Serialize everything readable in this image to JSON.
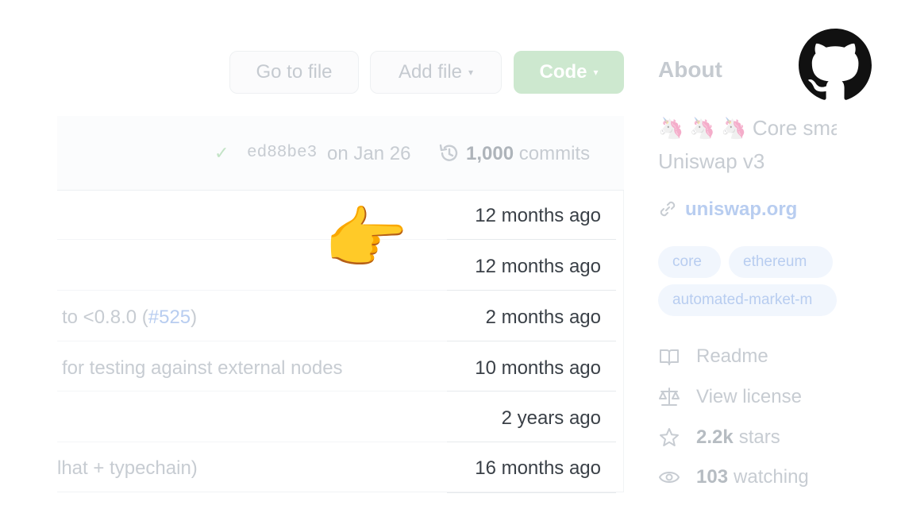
{
  "toolbar": {
    "go_to_file": "Go to file",
    "add_file": "Add file",
    "code": "Code",
    "caret": "▾"
  },
  "commit": {
    "check": "✓",
    "sha": "ed88be3",
    "date": "on Jan 26",
    "count": "1,000",
    "count_label": "commits"
  },
  "files": [
    {
      "message": "",
      "age": "12 months ago"
    },
    {
      "message": "",
      "age": "12 months ago"
    },
    {
      "message_prefix": "to <0.8.0 (",
      "link": "#525",
      "message_suffix": ")",
      "age": "2 months ago"
    },
    {
      "message": "for testing against external nodes",
      "age": "10 months ago"
    },
    {
      "message": "",
      "age": "2 years ago"
    },
    {
      "message": "lhat + typechain)",
      "age": "16 months ago"
    }
  ],
  "about": {
    "title": "About",
    "unicorns": "🦄 🦄 🦄",
    "desc_line1": "Core sma",
    "desc_line2": "Uniswap v3",
    "website": "uniswap.org",
    "topics": [
      "core",
      "ethereum",
      "automated-market-m"
    ],
    "readme": "Readme",
    "license": "View license",
    "stars_count": "2.2k",
    "stars_label": "stars",
    "watching_count": "103",
    "watching_label": "watching"
  },
  "overlay": {
    "pointer_emoji": "👈"
  },
  "colors": {
    "code_button": "#cde8cf",
    "link": "#b8cdf0",
    "topic_bg": "#f1f6fd"
  },
  "icons": [
    "history-icon",
    "link-icon",
    "book-icon",
    "scale-icon",
    "star-icon",
    "eye-icon",
    "github-logo-icon",
    "check-icon"
  ]
}
